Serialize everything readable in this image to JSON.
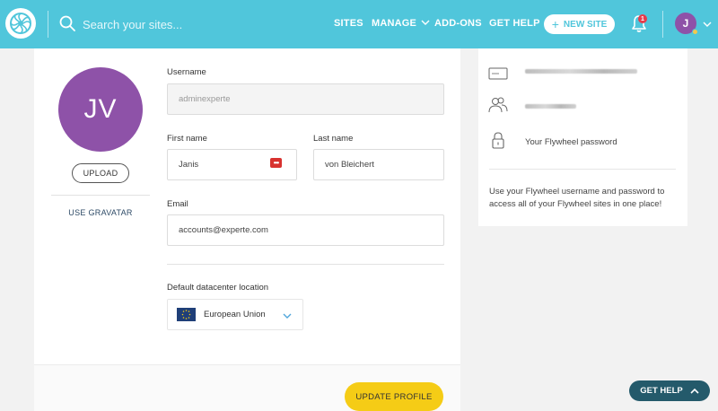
{
  "nav": {
    "search_placeholder": "Search your sites...",
    "links": {
      "sites": "SITES",
      "manage": "MANAGE",
      "addons": "ADD-ONS",
      "help": "GET HELP"
    },
    "new_site_label": "NEW SITE",
    "new_site_plus": "+",
    "notification_count": "1",
    "user_initial": "J",
    "brand_color": "#50c6db"
  },
  "profile": {
    "avatar_initials": "JV",
    "avatar_color": "#8e52a8",
    "upload_label": "UPLOAD",
    "gravatar_label": "USE GRAVATAR",
    "username_label": "Username",
    "username_value": "adminexperte",
    "firstname_label": "First name",
    "firstname_value": "Janis",
    "password_manager_glyph": "•••",
    "lastname_label": "Last name",
    "lastname_value": "von Bleichert",
    "email_label": "Email",
    "email_value": "accounts@experte.com",
    "datacenter_label": "Default datacenter location",
    "datacenter_value": "European Union",
    "update_label": "UPDATE PROFILE",
    "update_color": "#f5cc16"
  },
  "info": {
    "password_text": "Your Flywheel password",
    "note": "Use your Flywheel username and password to access all of your Flywheel sites in one place!"
  },
  "help_fab": {
    "label": "GET HELP",
    "color": "#245a6b"
  },
  "icons": [
    "flywheel-logo-icon",
    "search-icon",
    "chevron-down-icon",
    "plus-icon",
    "bell-icon",
    "id-card-icon",
    "users-icon",
    "lock-icon",
    "eu-flag-icon",
    "chevron-up-icon",
    "password-manager-icon"
  ]
}
